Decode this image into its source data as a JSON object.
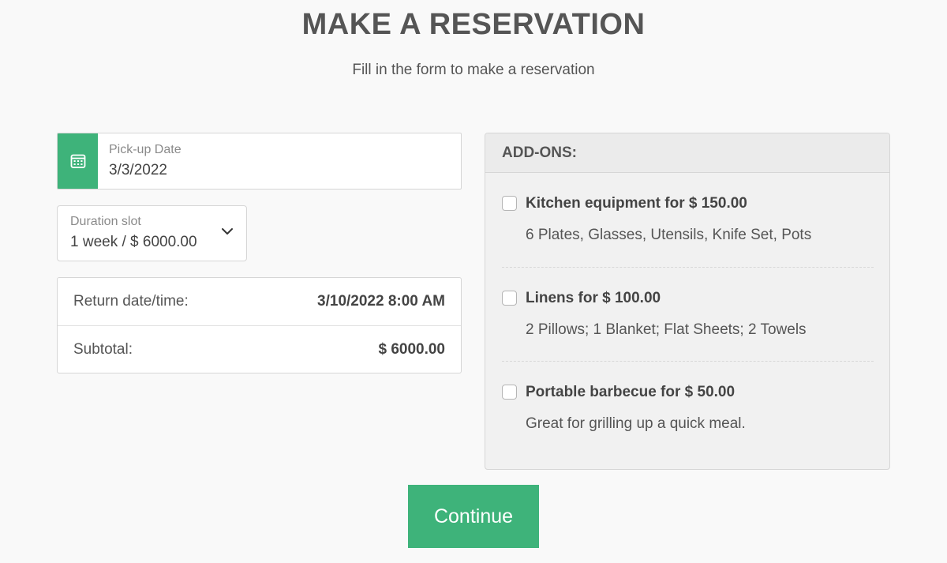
{
  "header": {
    "title": "MAKE A RESERVATION",
    "subtitle": "Fill in the form to make a reservation"
  },
  "pickup": {
    "label": "Pick-up Date",
    "value": "3/3/2022",
    "icon": "calendar-icon"
  },
  "duration": {
    "label": "Duration slot",
    "value": "1 week / $ 6000.00",
    "icon": "chevron-down-icon"
  },
  "summary": {
    "rows": [
      {
        "label": "Return date/time:",
        "value": "3/10/2022 8:00 AM"
      },
      {
        "label": "Subtotal:",
        "value": "$ 6000.00"
      }
    ]
  },
  "addons": {
    "heading": "ADD-ONS:",
    "items": [
      {
        "title": "Kitchen equipment for $ 150.00",
        "description": "6 Plates, Glasses, Utensils, Knife Set, Pots",
        "checked": false
      },
      {
        "title": "Linens for $ 100.00",
        "description": "2 Pillows; 1 Blanket; Flat Sheets; 2 Towels",
        "checked": false
      },
      {
        "title": "Portable barbecue for $ 50.00",
        "description": "Great for grilling up a quick meal.",
        "checked": false
      }
    ]
  },
  "actions": {
    "continue_label": "Continue"
  },
  "colors": {
    "accent": "#3eb37a",
    "background": "#f9f9f9",
    "text": "#555555"
  }
}
